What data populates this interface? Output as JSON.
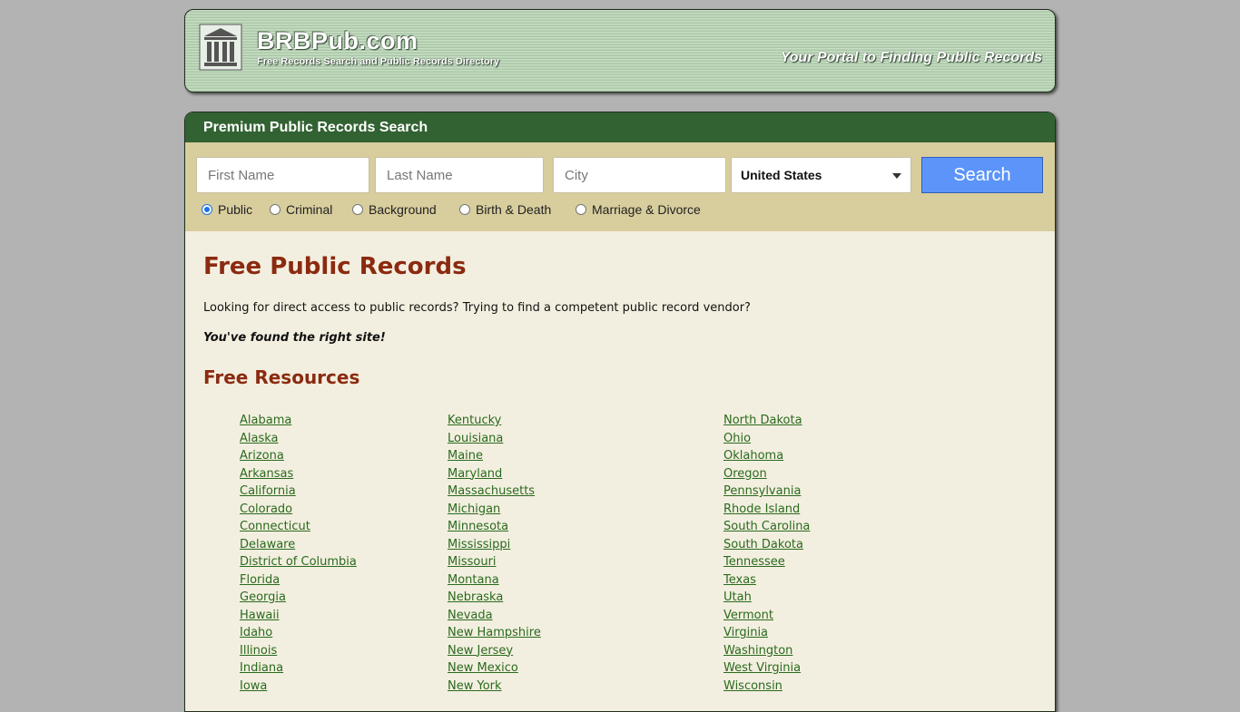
{
  "header": {
    "site_name": "BRBPub.com",
    "tagline": "Free Records Search and Public Records Directory",
    "portal_text": "Your Portal to Finding Public Records"
  },
  "search": {
    "title": "Premium Public Records Search",
    "first_name_placeholder": "First Name",
    "last_name_placeholder": "Last Name",
    "city_placeholder": "City",
    "country_selected": "United States",
    "button_label": "Search",
    "radio_options": [
      {
        "label": "Public",
        "checked": true
      },
      {
        "label": "Criminal",
        "checked": false
      },
      {
        "label": "Background",
        "checked": false
      },
      {
        "label": "Birth & Death",
        "checked": false
      },
      {
        "label": "Marriage & Divorce",
        "checked": false
      }
    ]
  },
  "content": {
    "title": "Free Public Records",
    "intro": "Looking for direct access to public records? Trying to find a competent public record vendor?",
    "found_text": "You've found the right site!",
    "resources_title": "Free Resources"
  },
  "states": {
    "col1": [
      "Alabama",
      "Alaska",
      "Arizona",
      "Arkansas",
      "California",
      "Colorado",
      "Connecticut",
      "Delaware",
      "District of Columbia",
      "Florida",
      "Georgia",
      "Hawaii",
      "Idaho",
      "Illinois",
      "Indiana",
      "Iowa"
    ],
    "col2": [
      "Kentucky",
      "Louisiana",
      "Maine",
      "Maryland",
      "Massachusetts",
      "Michigan",
      "Minnesota",
      "Mississippi",
      "Missouri",
      "Montana",
      "Nebraska",
      "Nevada",
      "New Hampshire",
      "New Jersey",
      "New Mexico",
      "New York"
    ],
    "col3": [
      "North Dakota",
      "Ohio",
      "Oklahoma",
      "Oregon",
      "Pennsylvania",
      "Rhode Island",
      "South Carolina",
      "South Dakota",
      "Tennessee",
      "Texas",
      "Utah",
      "Vermont",
      "Virginia",
      "Washington",
      "West Virginia",
      "Wisconsin"
    ]
  }
}
